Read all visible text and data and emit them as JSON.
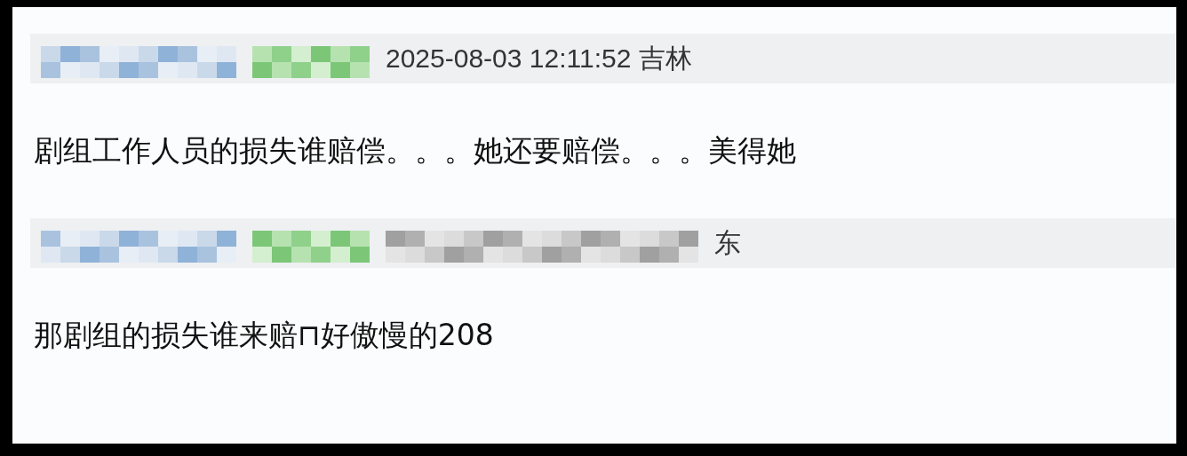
{
  "comments": [
    {
      "meta": {
        "time": "2025-08-03 12:11:52 吉林",
        "time_blurred": false
      },
      "text": "剧组工作人员的损失谁赔偿。。。她还要赔偿。。。美得她"
    },
    {
      "meta": {
        "time": "东",
        "time_blurred": true
      },
      "text": "那剧组的损失谁来赔⊓好傲慢的208"
    }
  ]
}
